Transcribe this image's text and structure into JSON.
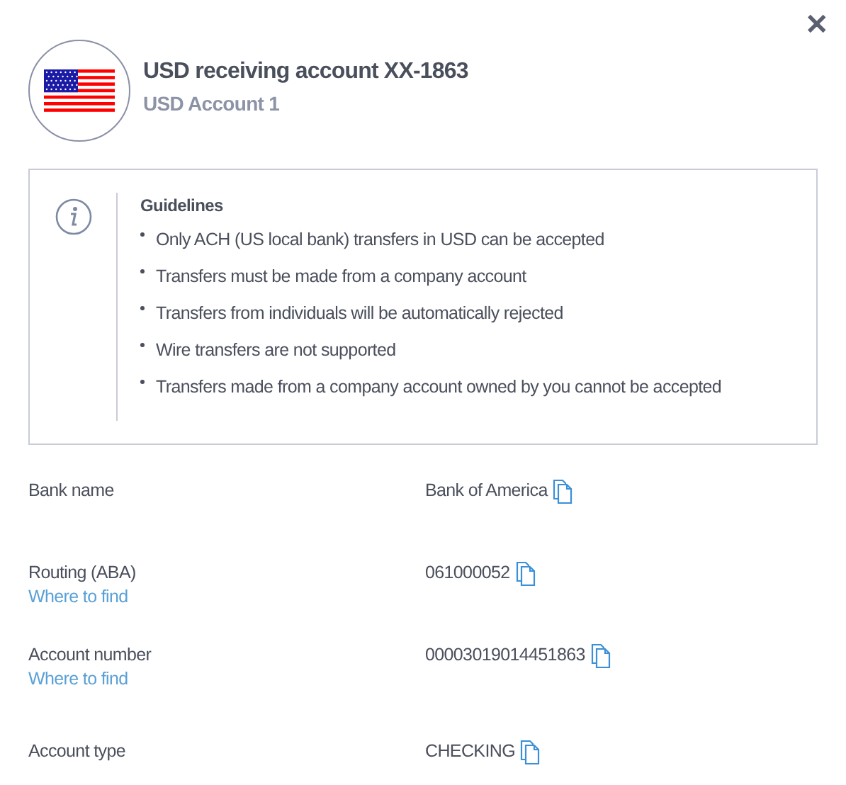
{
  "header": {
    "title": "USD receiving account XX-1863",
    "subtitle": "USD Account 1",
    "close": "✕"
  },
  "guidelines": {
    "title": "Guidelines",
    "items": [
      "Only ACH (US local bank) transfers in USD can be accepted",
      "Transfers must be made from a company account",
      "Transfers from individuals will be automatically rejected",
      "Wire transfers are not supported",
      "Transfers made from a company account owned by you cannot be accepted"
    ]
  },
  "details": [
    {
      "label": "Bank name",
      "value": "Bank of America"
    },
    {
      "label": "Routing (ABA)",
      "link": "Where to find",
      "value": "061000052"
    },
    {
      "label": "Account number",
      "link": "Where to find",
      "value": "00003019014451863"
    },
    {
      "label": "Account type",
      "value": "CHECKING"
    }
  ]
}
